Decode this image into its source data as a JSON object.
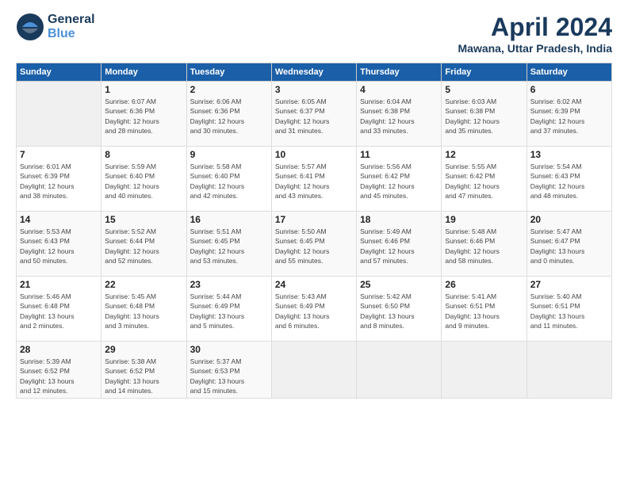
{
  "logo": {
    "line1": "General",
    "line2": "Blue"
  },
  "title": "April 2024",
  "location": "Mawana, Uttar Pradesh, India",
  "headers": [
    "Sunday",
    "Monday",
    "Tuesday",
    "Wednesday",
    "Thursday",
    "Friday",
    "Saturday"
  ],
  "weeks": [
    [
      {
        "num": "",
        "info": ""
      },
      {
        "num": "1",
        "info": "Sunrise: 6:07 AM\nSunset: 6:36 PM\nDaylight: 12 hours\nand 28 minutes."
      },
      {
        "num": "2",
        "info": "Sunrise: 6:06 AM\nSunset: 6:36 PM\nDaylight: 12 hours\nand 30 minutes."
      },
      {
        "num": "3",
        "info": "Sunrise: 6:05 AM\nSunset: 6:37 PM\nDaylight: 12 hours\nand 31 minutes."
      },
      {
        "num": "4",
        "info": "Sunrise: 6:04 AM\nSunset: 6:38 PM\nDaylight: 12 hours\nand 33 minutes."
      },
      {
        "num": "5",
        "info": "Sunrise: 6:03 AM\nSunset: 6:38 PM\nDaylight: 12 hours\nand 35 minutes."
      },
      {
        "num": "6",
        "info": "Sunrise: 6:02 AM\nSunset: 6:39 PM\nDaylight: 12 hours\nand 37 minutes."
      }
    ],
    [
      {
        "num": "7",
        "info": "Sunrise: 6:01 AM\nSunset: 6:39 PM\nDaylight: 12 hours\nand 38 minutes."
      },
      {
        "num": "8",
        "info": "Sunrise: 5:59 AM\nSunset: 6:40 PM\nDaylight: 12 hours\nand 40 minutes."
      },
      {
        "num": "9",
        "info": "Sunrise: 5:58 AM\nSunset: 6:40 PM\nDaylight: 12 hours\nand 42 minutes."
      },
      {
        "num": "10",
        "info": "Sunrise: 5:57 AM\nSunset: 6:41 PM\nDaylight: 12 hours\nand 43 minutes."
      },
      {
        "num": "11",
        "info": "Sunrise: 5:56 AM\nSunset: 6:42 PM\nDaylight: 12 hours\nand 45 minutes."
      },
      {
        "num": "12",
        "info": "Sunrise: 5:55 AM\nSunset: 6:42 PM\nDaylight: 12 hours\nand 47 minutes."
      },
      {
        "num": "13",
        "info": "Sunrise: 5:54 AM\nSunset: 6:43 PM\nDaylight: 12 hours\nand 48 minutes."
      }
    ],
    [
      {
        "num": "14",
        "info": "Sunrise: 5:53 AM\nSunset: 6:43 PM\nDaylight: 12 hours\nand 50 minutes."
      },
      {
        "num": "15",
        "info": "Sunrise: 5:52 AM\nSunset: 6:44 PM\nDaylight: 12 hours\nand 52 minutes."
      },
      {
        "num": "16",
        "info": "Sunrise: 5:51 AM\nSunset: 6:45 PM\nDaylight: 12 hours\nand 53 minutes."
      },
      {
        "num": "17",
        "info": "Sunrise: 5:50 AM\nSunset: 6:45 PM\nDaylight: 12 hours\nand 55 minutes."
      },
      {
        "num": "18",
        "info": "Sunrise: 5:49 AM\nSunset: 6:46 PM\nDaylight: 12 hours\nand 57 minutes."
      },
      {
        "num": "19",
        "info": "Sunrise: 5:48 AM\nSunset: 6:46 PM\nDaylight: 12 hours\nand 58 minutes."
      },
      {
        "num": "20",
        "info": "Sunrise: 5:47 AM\nSunset: 6:47 PM\nDaylight: 13 hours\nand 0 minutes."
      }
    ],
    [
      {
        "num": "21",
        "info": "Sunrise: 5:46 AM\nSunset: 6:48 PM\nDaylight: 13 hours\nand 2 minutes."
      },
      {
        "num": "22",
        "info": "Sunrise: 5:45 AM\nSunset: 6:48 PM\nDaylight: 13 hours\nand 3 minutes."
      },
      {
        "num": "23",
        "info": "Sunrise: 5:44 AM\nSunset: 6:49 PM\nDaylight: 13 hours\nand 5 minutes."
      },
      {
        "num": "24",
        "info": "Sunrise: 5:43 AM\nSunset: 6:49 PM\nDaylight: 13 hours\nand 6 minutes."
      },
      {
        "num": "25",
        "info": "Sunrise: 5:42 AM\nSunset: 6:50 PM\nDaylight: 13 hours\nand 8 minutes."
      },
      {
        "num": "26",
        "info": "Sunrise: 5:41 AM\nSunset: 6:51 PM\nDaylight: 13 hours\nand 9 minutes."
      },
      {
        "num": "27",
        "info": "Sunrise: 5:40 AM\nSunset: 6:51 PM\nDaylight: 13 hours\nand 11 minutes."
      }
    ],
    [
      {
        "num": "28",
        "info": "Sunrise: 5:39 AM\nSunset: 6:52 PM\nDaylight: 13 hours\nand 12 minutes."
      },
      {
        "num": "29",
        "info": "Sunrise: 5:38 AM\nSunset: 6:52 PM\nDaylight: 13 hours\nand 14 minutes."
      },
      {
        "num": "30",
        "info": "Sunrise: 5:37 AM\nSunset: 6:53 PM\nDaylight: 13 hours\nand 15 minutes."
      },
      {
        "num": "",
        "info": ""
      },
      {
        "num": "",
        "info": ""
      },
      {
        "num": "",
        "info": ""
      },
      {
        "num": "",
        "info": ""
      }
    ]
  ]
}
